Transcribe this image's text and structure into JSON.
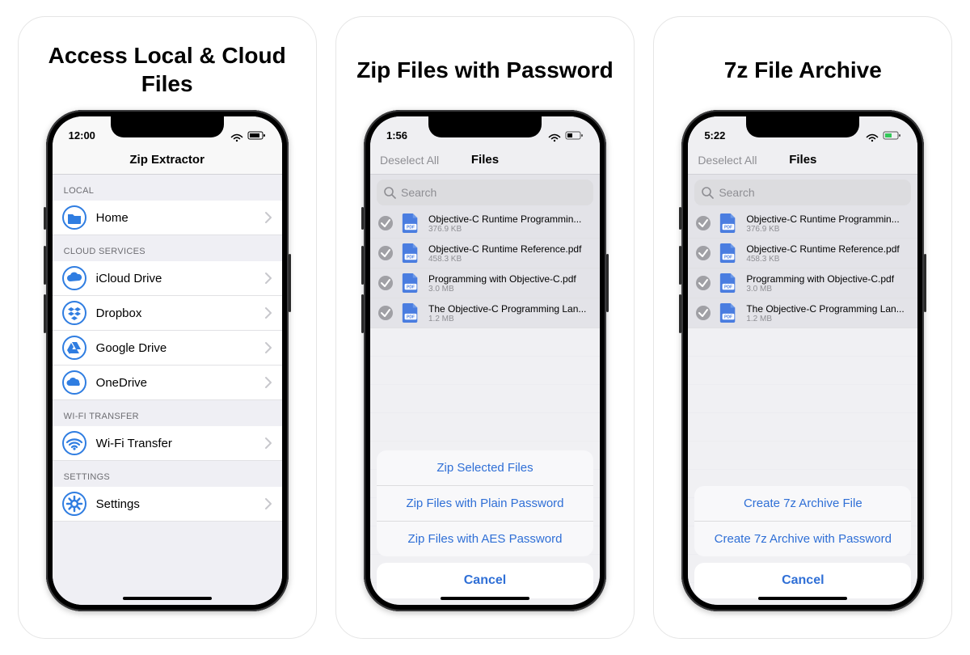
{
  "panels": [
    {
      "title": "Access Local & Cloud Files"
    },
    {
      "title": "Zip Files with Password"
    },
    {
      "title": "7z File Archive"
    }
  ],
  "panel1": {
    "status_time": "12:00",
    "nav_title": "Zip Extractor",
    "sections": {
      "local_header": "LOCAL",
      "cloud_header": "CLOUD SERVICES",
      "wifi_header": "WI-FI TRANSFER",
      "settings_header": "SETTINGS"
    },
    "rows": {
      "home": "Home",
      "icloud": "iCloud Drive",
      "dropbox": "Dropbox",
      "gdrive": "Google Drive",
      "onedrive": "OneDrive",
      "wifi": "Wi-Fi Transfer",
      "settings": "Settings"
    }
  },
  "common_files": {
    "status": {
      "deselect": "Deselect All",
      "nav_title": "Files",
      "search_placeholder": "Search"
    },
    "files": [
      {
        "name": "Objective-C Runtime Programmin...",
        "size": "376.9 KB"
      },
      {
        "name": "Objective-C Runtime Reference.pdf",
        "size": "458.3 KB"
      },
      {
        "name": "Programming with Objective-C.pdf",
        "size": "3.0 MB"
      },
      {
        "name": "The Objective-C Programming Lan...",
        "size": "1.2 MB"
      }
    ]
  },
  "panel2": {
    "status_time": "1:56",
    "sheet": {
      "items": [
        "Zip Selected Files",
        "Zip Files with Plain Password",
        "Zip Files with AES Password"
      ],
      "cancel": "Cancel"
    }
  },
  "panel3": {
    "status_time": "5:22",
    "sheet": {
      "items": [
        "Create 7z Archive File",
        "Create 7z Archive with Password"
      ],
      "cancel": "Cancel"
    }
  }
}
